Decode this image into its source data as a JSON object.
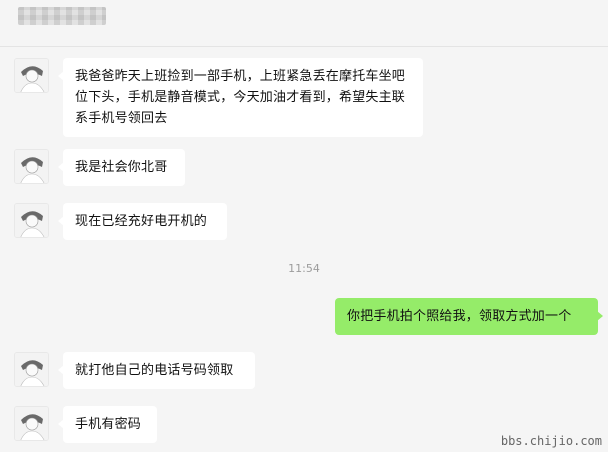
{
  "messages": [
    {
      "side": "left",
      "text": "我爸爸昨天上班捡到一部手机，上班紧急丢在摩托车坐吧位下头，手机是静音模式，今天加油才看到，希望失主联系手机号领回去"
    },
    {
      "side": "left",
      "text": "我是社会你北哥"
    },
    {
      "side": "left",
      "text": "现在已经充好电开机的"
    },
    {
      "side": "time",
      "text": "11:54"
    },
    {
      "side": "right",
      "text": "你把手机拍个照给我，领取方式加一个"
    },
    {
      "side": "left",
      "text": "就打他自己的电话号码领取"
    },
    {
      "side": "left",
      "text": "手机有密码"
    }
  ],
  "watermark": "bbs.chijio.com",
  "colors": {
    "outgoing": "#95ec69",
    "incoming": "#ffffff",
    "background": "#f5f5f5"
  }
}
